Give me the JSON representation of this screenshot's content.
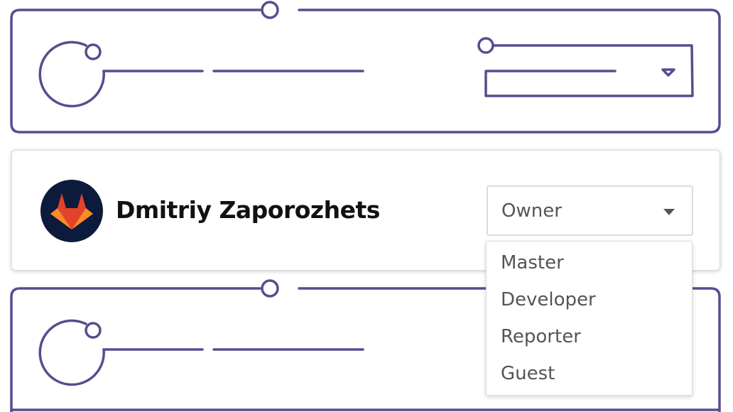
{
  "colors": {
    "outline": "#5c4a90",
    "avatar_bg": "#0c1a3c",
    "text_dark": "#111111",
    "text_muted": "#555555",
    "border_light": "#dcdcdc"
  },
  "member": {
    "name": "Dmitriy Zaporozhets",
    "avatar_icon": "gitlab-tanuki-logo",
    "role": {
      "selected": "Owner",
      "options": [
        "Master",
        "Developer",
        "Reporter",
        "Guest"
      ]
    }
  },
  "placeholders": {
    "top_card": "outlined wireframe member row with avatar, name line and dropdown",
    "bottom_card": "outlined wireframe member row with avatar and name line"
  }
}
